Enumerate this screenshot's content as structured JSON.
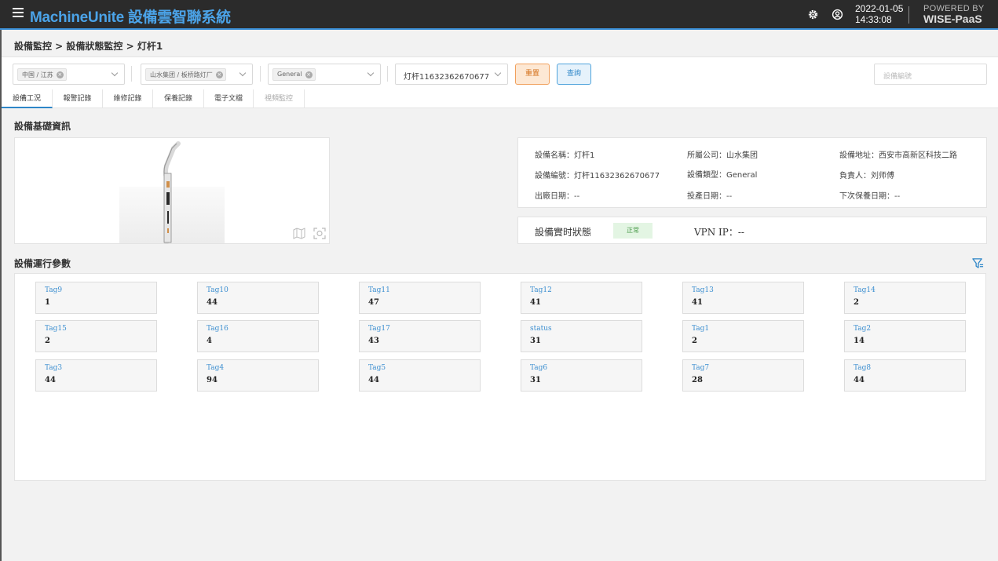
{
  "header": {
    "brand": "MachineUnite 設備雲智聯系統",
    "date": "2022-01-05",
    "time": "14:33:08",
    "powered_line1": "POWERED BY",
    "powered_line2": "WISE-PaaS"
  },
  "breadcrumb": "設備監控 > 設備狀態監控 > 灯杆1",
  "filters": {
    "region": "中国 / 江苏",
    "company": "山水集团 / 板桥路灯厂",
    "type": "General",
    "device": "灯杆11632362670677",
    "reset_label": "重置",
    "query_label": "查詢",
    "search_placeholder": "設備編號"
  },
  "tabs": [
    {
      "label": "設備工況"
    },
    {
      "label": "報警記錄"
    },
    {
      "label": "維修記錄"
    },
    {
      "label": "保養記錄"
    },
    {
      "label": "電子文檔"
    },
    {
      "label": "視頻監控"
    }
  ],
  "basic_info": {
    "title": "設備基礎資訊",
    "name": "設備名稱：灯杆1",
    "company": "所屬公司：山水集团",
    "address": "設備地址：西安市高新区科技二路",
    "code": "設備編號：灯杆11632362670677",
    "type": "設備類型：General",
    "owner": "負責人：刘师傅",
    "factory_date": "出廠日期：--",
    "operation_date": "投產日期：--",
    "next_maintenance": "下次保養日期：--"
  },
  "status": {
    "label": "設備實时狀態",
    "value": "正常",
    "vpn": "VPN IP：--"
  },
  "params": {
    "title": "設備運行參數",
    "tags": [
      {
        "name": "Tag9",
        "value": "1"
      },
      {
        "name": "Tag10",
        "value": "44"
      },
      {
        "name": "Tag11",
        "value": "47"
      },
      {
        "name": "Tag12",
        "value": "41"
      },
      {
        "name": "Tag13",
        "value": "41"
      },
      {
        "name": "Tag14",
        "value": "2"
      },
      {
        "name": "Tag15",
        "value": "2"
      },
      {
        "name": "Tag16",
        "value": "4"
      },
      {
        "name": "Tag17",
        "value": "43"
      },
      {
        "name": "status",
        "value": "31"
      },
      {
        "name": "Tag1",
        "value": "2"
      },
      {
        "name": "Tag2",
        "value": "14"
      },
      {
        "name": "Tag3",
        "value": "44"
      },
      {
        "name": "Tag4",
        "value": "94"
      },
      {
        "name": "Tag5",
        "value": "44"
      },
      {
        "name": "Tag6",
        "value": "31"
      },
      {
        "name": "Tag7",
        "value": "28"
      },
      {
        "name": "Tag8",
        "value": "44"
      }
    ]
  }
}
